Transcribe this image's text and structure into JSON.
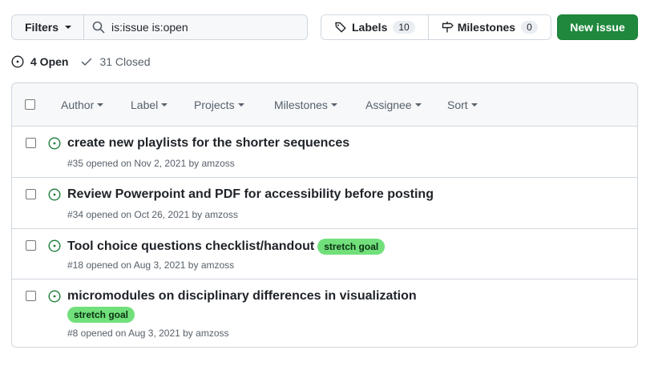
{
  "toolbar": {
    "filters_label": "Filters",
    "search_value": "is:issue is:open",
    "labels_label": "Labels",
    "labels_count": "10",
    "milestones_label": "Milestones",
    "milestones_count": "0",
    "new_issue_label": "New issue"
  },
  "states": {
    "open_label": "4 Open",
    "closed_label": "31 Closed"
  },
  "header_filters": [
    "Author",
    "Label",
    "Projects",
    "Milestones",
    "Assignee",
    "Sort"
  ],
  "issues": [
    {
      "title": "create new playlists for the shorter sequences",
      "meta": "#35 opened on Nov 2, 2021 by amzoss",
      "label": ""
    },
    {
      "title": "Review Powerpoint and PDF for accessibility before posting",
      "meta": "#34 opened on Oct 26, 2021 by amzoss",
      "label": ""
    },
    {
      "title": "Tool choice questions checklist/handout",
      "meta": "#18 opened on Aug 3, 2021 by amzoss",
      "label": "stretch goal"
    },
    {
      "title": "micromodules on disciplinary differences in visualization",
      "meta": "#8 opened on Aug 3, 2021 by amzoss",
      "label": "stretch goal"
    }
  ],
  "colors": {
    "open_icon": "#1a7f37",
    "primary_button": "#1f883d",
    "label_stretch_goal": "#71e07b"
  }
}
